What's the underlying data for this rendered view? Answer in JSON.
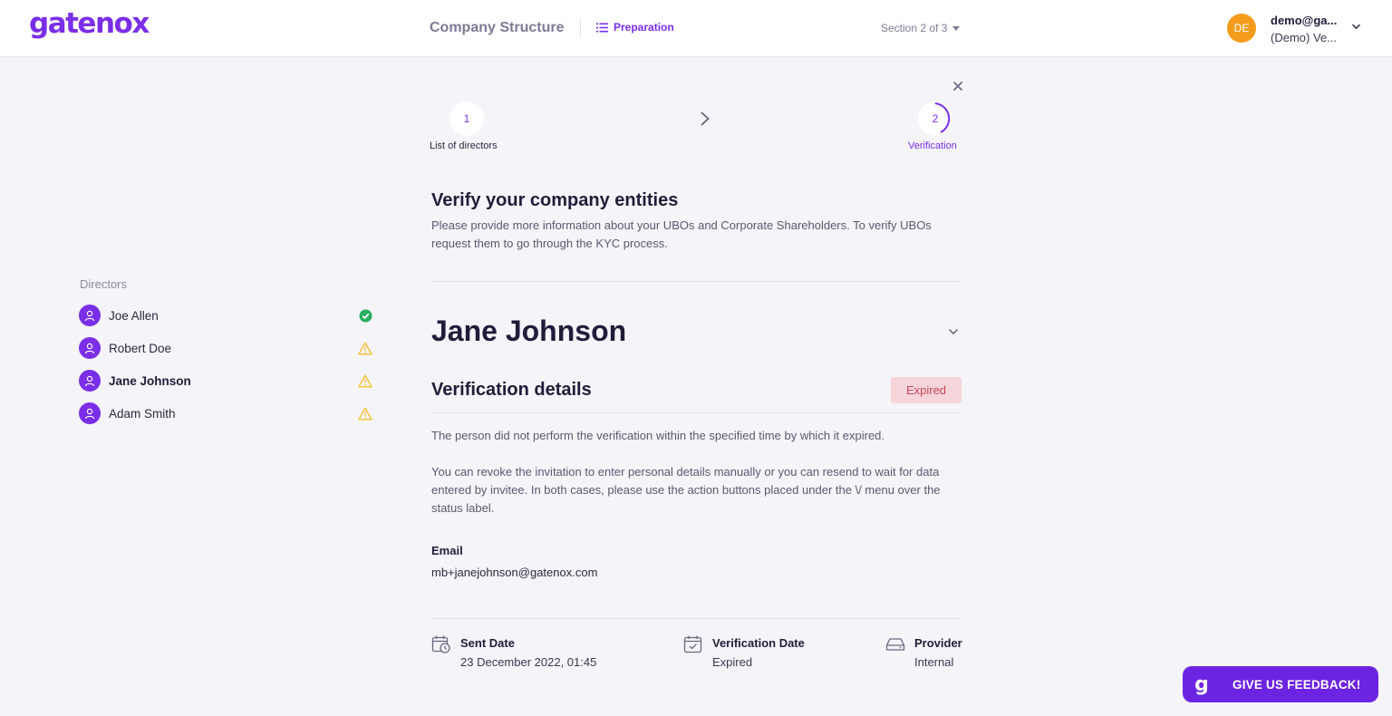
{
  "header": {
    "logo": "gatenox",
    "title": "Company Structure",
    "preparation_label": "Preparation",
    "section_label": "Section 2 of 3",
    "user_initials": "DE",
    "user_email": "demo@ga...",
    "user_org": "(Demo) Ve..."
  },
  "sidebar": {
    "heading": "Directors",
    "directors": [
      {
        "name": "Joe Allen",
        "status": "verified",
        "status_icon": "check-circle-icon"
      },
      {
        "name": "Robert Doe",
        "status": "warning",
        "status_icon": "warning-icon"
      },
      {
        "name": "Jane Johnson",
        "status": "warning",
        "status_icon": "warning-icon",
        "active": true
      },
      {
        "name": "Adam Smith",
        "status": "warning",
        "status_icon": "warning-icon"
      }
    ]
  },
  "stepper": {
    "steps": [
      {
        "number": "1",
        "label": "List of directors"
      },
      {
        "number": "2",
        "label": "Verification"
      }
    ],
    "current_step": 2
  },
  "main": {
    "title": "Verify your company entities",
    "description": "Please provide more information about your UBOs and Corporate Shareholders. To verify UBOs request them to go through the KYC process.",
    "person_name": "Jane Johnson",
    "verification": {
      "title": "Verification details",
      "status": "Expired",
      "paragraph1": "The person did not perform the verification within the specified time by which it expired.",
      "paragraph2": "You can revoke the invitation to enter personal details manually or you can resend to wait for data entered by invitee. In both cases, please use the action buttons placed under the \\/ menu over the status label.",
      "email_label": "Email",
      "email_value": "mb+janejohnson@gatenox.com",
      "sent_label": "Sent Date",
      "sent_value": "23 December 2022, 01:45",
      "verification_date_label": "Verification Date",
      "verification_date_value": "Expired",
      "provider_label": "Provider",
      "provider_value": "Internal"
    }
  },
  "feedback": {
    "logo_letter": "g",
    "label": "GIVE US FEEDBACK!"
  },
  "colors": {
    "brand": "#7b2ee8",
    "background": "#f5f4f8",
    "expired_bg": "#f5d5da",
    "expired_text": "#c8455a",
    "success": "#27ae60",
    "warning": "#f2c230"
  }
}
